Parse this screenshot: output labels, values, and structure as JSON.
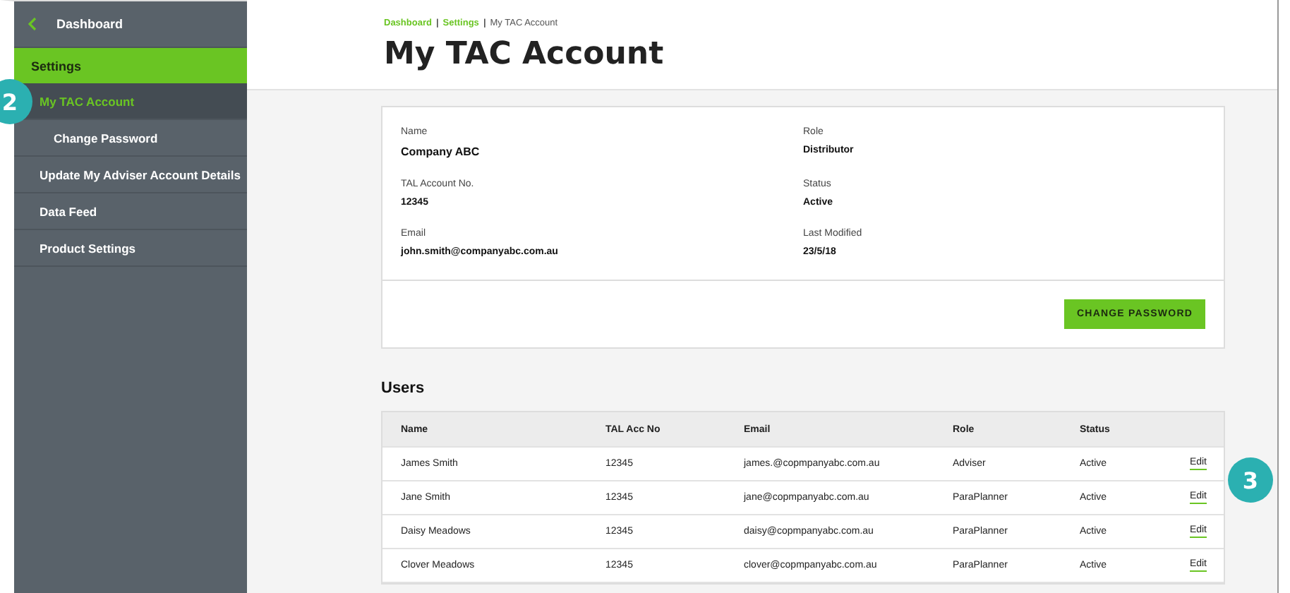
{
  "sidebar": {
    "back": {
      "label": "Dashboard"
    },
    "section": {
      "label": "Settings",
      "selected": true
    },
    "items": [
      {
        "label": "My TAC Account",
        "selected": true,
        "children": [
          {
            "label": "Change Password",
            "selected": false
          }
        ]
      },
      {
        "label": "Update My Adviser Account Details",
        "selected": false
      },
      {
        "label": "Data Feed",
        "selected": false
      },
      {
        "label": "Product Settings",
        "selected": false
      }
    ]
  },
  "breadcrumb": {
    "separator": "|",
    "items": [
      {
        "label": "Dashboard",
        "link": true
      },
      {
        "label": "Settings",
        "link": true
      },
      {
        "label": "My TAC Account",
        "link": false
      }
    ]
  },
  "page_title": "My TAC Account",
  "account": {
    "fields": [
      {
        "label": "Name",
        "value": "Company ABC"
      },
      {
        "label": "Role",
        "value": "Distributor"
      },
      {
        "label": "TAL Account No.",
        "value": "12345"
      },
      {
        "label": "Status",
        "value": "Active"
      },
      {
        "label": "Email",
        "value": "john.smith@companyabc.com.au"
      },
      {
        "label": "Last Modified",
        "value": "23/5/18"
      }
    ],
    "button": "CHANGE PASSWORD"
  },
  "users": {
    "title": "Users",
    "columns": [
      "Name",
      "TAL Acc No",
      "Email",
      "Role",
      "Status"
    ],
    "rows": [
      {
        "cells": [
          "James Smith",
          "12345",
          "james.@copmpanyabc.com.au",
          "Adviser",
          "Active"
        ],
        "action": "Edit"
      },
      {
        "cells": [
          "Jane Smith",
          "12345",
          "jane@copmpanyabc.com.au",
          "ParaPlanner",
          "Active"
        ],
        "action": "Edit"
      },
      {
        "cells": [
          "Daisy Meadows",
          "12345",
          "daisy@copmpanyabc.com.au",
          "ParaPlanner",
          "Active"
        ],
        "action": "Edit"
      },
      {
        "cells": [
          "Clover Meadows",
          "12345",
          "clover@copmpanyabc.com.au",
          "ParaPlanner",
          "Active"
        ],
        "action": "Edit"
      }
    ]
  },
  "callouts": [
    {
      "label": "2"
    },
    {
      "label": "3"
    }
  ]
}
